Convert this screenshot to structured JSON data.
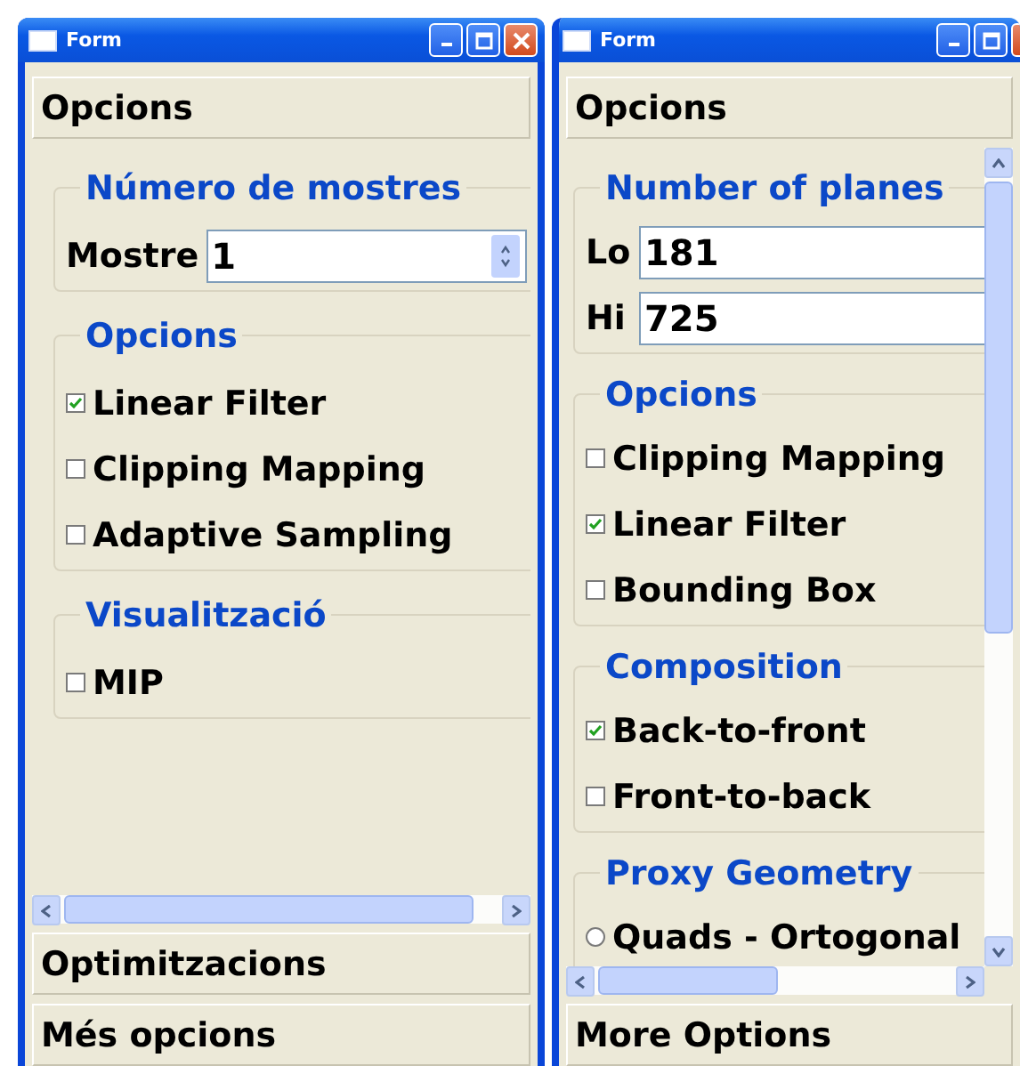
{
  "windows": [
    {
      "title": "Form",
      "top_page": "Opcions",
      "vertical_scrollbar": false,
      "groups": [
        {
          "title": "Número de mostres",
          "items": [
            {
              "kind": "spinbox",
              "label": "Mostre",
              "value": "1"
            }
          ]
        },
        {
          "title": "Opcions",
          "items": [
            {
              "kind": "checkbox",
              "label": "Linear Filter",
              "checked": true
            },
            {
              "kind": "checkbox",
              "label": "Clipping Mapping",
              "checked": false
            },
            {
              "kind": "checkbox",
              "label": "Adaptive Sampling",
              "checked": false
            }
          ]
        },
        {
          "title": "Visualització",
          "items": [
            {
              "kind": "checkbox",
              "label": "MIP",
              "checked": false
            }
          ]
        }
      ],
      "bottom_pages": [
        "Optimitzacions",
        "Més opcions"
      ]
    },
    {
      "title": "Form",
      "top_page": "Opcions",
      "vertical_scrollbar": true,
      "groups": [
        {
          "title": "Number of planes",
          "items": [
            {
              "kind": "field",
              "label": "Lo",
              "value": "181"
            },
            {
              "kind": "field",
              "label": "Hi",
              "value": "725"
            }
          ]
        },
        {
          "title": "Opcions",
          "items": [
            {
              "kind": "checkbox",
              "label": "Clipping Mapping",
              "checked": false
            },
            {
              "kind": "checkbox",
              "label": "Linear Filter",
              "checked": true
            },
            {
              "kind": "checkbox",
              "label": "Bounding Box",
              "checked": false
            }
          ]
        },
        {
          "title": "Composition",
          "items": [
            {
              "kind": "checkbox",
              "label": "Back-to-front",
              "checked": true
            },
            {
              "kind": "checkbox",
              "label": "Front-to-back",
              "checked": false
            }
          ]
        },
        {
          "title": "Proxy Geometry",
          "items": [
            {
              "kind": "radio",
              "label": "Quads - Ortogonal",
              "selected": false
            }
          ]
        }
      ],
      "bottom_pages": [
        "More Options"
      ]
    }
  ]
}
